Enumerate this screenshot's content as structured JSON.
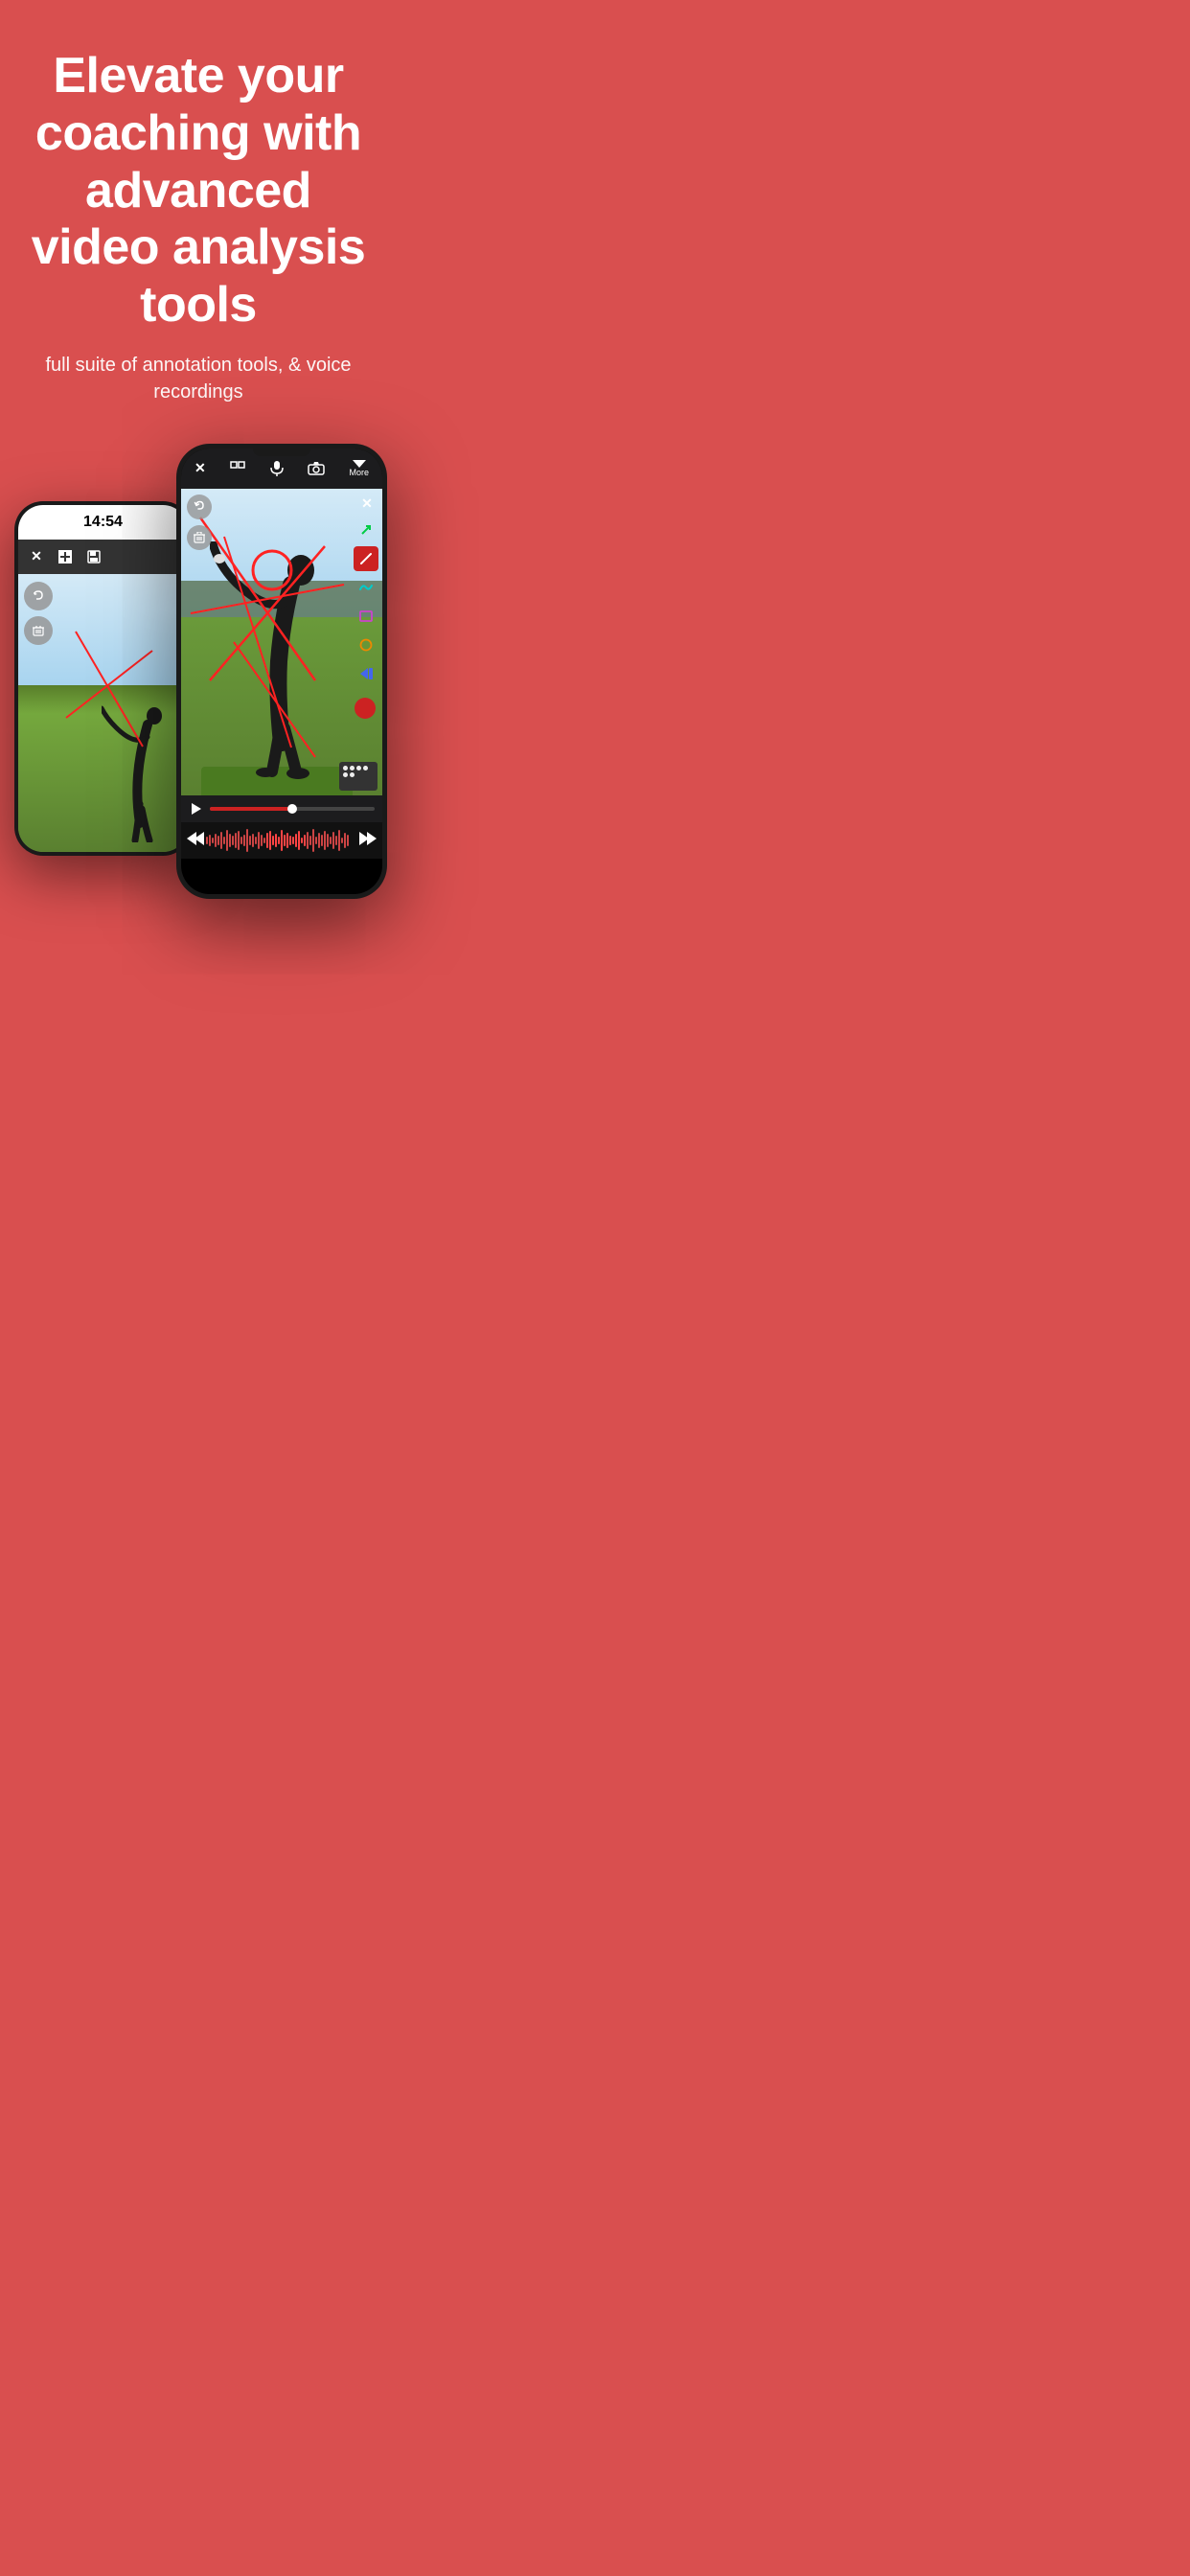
{
  "hero": {
    "title": "Elevate your coaching with advanced video analysis tools",
    "subtitle": "full suite of annotation tools, & voice recordings"
  },
  "back_phone": {
    "time": "14:54",
    "toolbar": {
      "close": "✕",
      "layout": "⊞",
      "save": "💾"
    }
  },
  "front_phone": {
    "toolbar": {
      "close": "✕",
      "grid": "⊞",
      "mic": "🎤",
      "camera": "📷",
      "more": "More"
    },
    "tools": {
      "arrow": "↗",
      "pen": "/",
      "wave": "〜",
      "rect": "□",
      "circle": "○",
      "fill": "◀"
    }
  },
  "waveform": {
    "heights": [
      8,
      12,
      6,
      14,
      10,
      18,
      8,
      22,
      14,
      10,
      16,
      20,
      8,
      12,
      24,
      10,
      14,
      8,
      18,
      12,
      6,
      16,
      20,
      10,
      14,
      8,
      22,
      12,
      16,
      10,
      8,
      14,
      20,
      6,
      12,
      18,
      10,
      24,
      8,
      16,
      12,
      20,
      14,
      8,
      18,
      10,
      22,
      6,
      16,
      12
    ]
  }
}
